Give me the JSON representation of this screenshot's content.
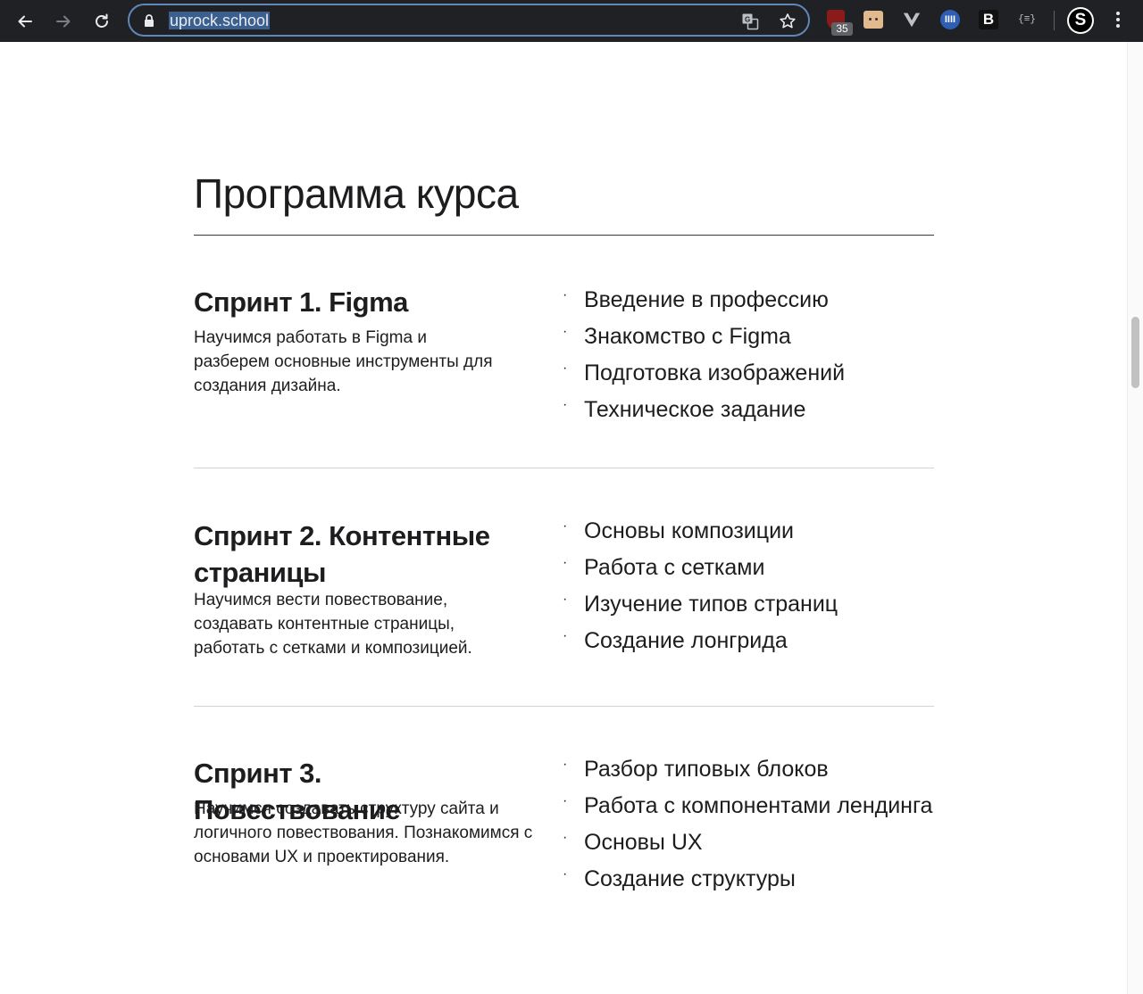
{
  "browser": {
    "url": "uprock.school",
    "ublock_badge": "35",
    "ext_b_label": "B",
    "ext_json_label": "{≡}",
    "avatar_letter": "S"
  },
  "page": {
    "title": "Программа курса",
    "sprints": [
      {
        "title": "Спринт 1. Figma",
        "description": "Научимся работать в Figma и разберем основные инструменты для создания дизайна.",
        "bullet": "·",
        "topics": [
          "Введение в профессию",
          "Знакомство с Figma",
          "Подготовка изображений",
          "Техническое задание"
        ]
      },
      {
        "title": "Спринт 2. Контентные страницы",
        "description": "Научимся вести повествование, создавать контентные страницы, работать с сетками и композицией.",
        "bullet": "·",
        "topics": [
          "Основы композиции",
          "Работа с сетками",
          "Изучение типов страниц",
          "Создание лонгрида"
        ]
      },
      {
        "title": "Спринт 3. Повествование",
        "description": "Научимся создавать структуру сайта и логичного повествования. Познакомимся с основами UX и проектирования.",
        "bullet": "·",
        "topics": [
          "Разбор типовых блоков",
          "Работа с компонентами лендинга",
          "Основы UX",
          "Создание структуры"
        ]
      }
    ]
  }
}
